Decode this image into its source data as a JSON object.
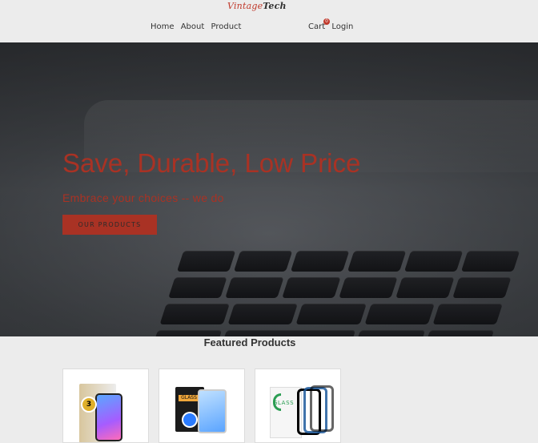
{
  "brand": {
    "part1": "Vintage",
    "part2": "Tech"
  },
  "nav": {
    "left": [
      "Home",
      "About",
      "Product"
    ],
    "right": {
      "cart_label": "Cart",
      "cart_count": "0",
      "login_label": "Login"
    }
  },
  "hero": {
    "title": "Save, Durable, Low Price",
    "subtitle": "Embrace your choices -- we do",
    "cta": "OUR PRODUCTS"
  },
  "featured": {
    "title": "Featured Products"
  },
  "products": [
    {
      "badge": "3"
    },
    {
      "label": "GLASS"
    },
    {
      "label": "GLASS"
    }
  ],
  "colors": {
    "accent": "#a93224",
    "background": "#ececec"
  }
}
